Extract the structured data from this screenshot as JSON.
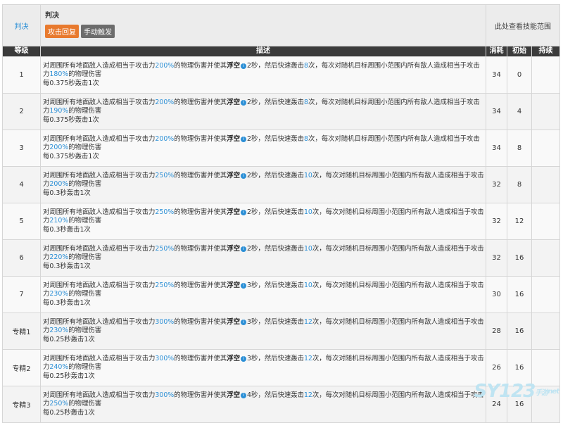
{
  "skill": {
    "link_label": "判决",
    "name": "判决",
    "tags": [
      "攻击回复",
      "手动触发"
    ],
    "range_label": "此处查看技能范围"
  },
  "columns": [
    "等级",
    "描述",
    "消耗",
    "初始",
    "持续"
  ],
  "desc_text": {
    "p1": "对周围所有地面敌人造成相当于攻击力",
    "p2": "的物理伤害并使其",
    "keyword": "浮空",
    "info_icon": "i",
    "p3": "秒，然后快速轰击",
    "p4": "次，每次对随机目标周围小范围内所有敌人造成相当于攻击力",
    "p5": "的物理伤害",
    "p6a": "每",
    "p6b": "秒轰击1次"
  },
  "rows": [
    {
      "level": "1",
      "pct1": "200%",
      "float": "2",
      "hits": "8",
      "pct2": "180%",
      "interval": "0.375",
      "cost": "34",
      "init": "0",
      "dur": ""
    },
    {
      "level": "2",
      "pct1": "200%",
      "float": "2",
      "hits": "8",
      "pct2": "190%",
      "interval": "0.375",
      "cost": "34",
      "init": "4",
      "dur": ""
    },
    {
      "level": "3",
      "pct1": "200%",
      "float": "2",
      "hits": "8",
      "pct2": "200%",
      "interval": "0.375",
      "cost": "34",
      "init": "8",
      "dur": ""
    },
    {
      "level": "4",
      "pct1": "250%",
      "float": "2",
      "hits": "10",
      "pct2": "200%",
      "interval": "0.3",
      "cost": "32",
      "init": "8",
      "dur": ""
    },
    {
      "level": "5",
      "pct1": "250%",
      "float": "2",
      "hits": "10",
      "pct2": "210%",
      "interval": "0.3",
      "cost": "32",
      "init": "12",
      "dur": ""
    },
    {
      "level": "6",
      "pct1": "250%",
      "float": "2",
      "hits": "10",
      "pct2": "220%",
      "interval": "0.3",
      "cost": "32",
      "init": "16",
      "dur": ""
    },
    {
      "level": "7",
      "pct1": "250%",
      "float": "3",
      "hits": "10",
      "pct2": "230%",
      "interval": "0.3",
      "cost": "30",
      "init": "16",
      "dur": ""
    },
    {
      "level": "专精1",
      "pct1": "300%",
      "float": "3",
      "hits": "12",
      "pct2": "230%",
      "interval": "0.25",
      "cost": "28",
      "init": "16",
      "dur": ""
    },
    {
      "level": "专精2",
      "pct1": "300%",
      "float": "3",
      "hits": "12",
      "pct2": "240%",
      "interval": "0.25",
      "cost": "26",
      "init": "16",
      "dur": ""
    },
    {
      "level": "专精3",
      "pct1": "300%",
      "float": "4",
      "hits": "12",
      "pct2": "250%",
      "interval": "0.25",
      "cost": "24",
      "init": "16",
      "dur": ""
    }
  ],
  "watermark": {
    "main": "SY123",
    "sub": "手游",
    "domain": "net"
  }
}
